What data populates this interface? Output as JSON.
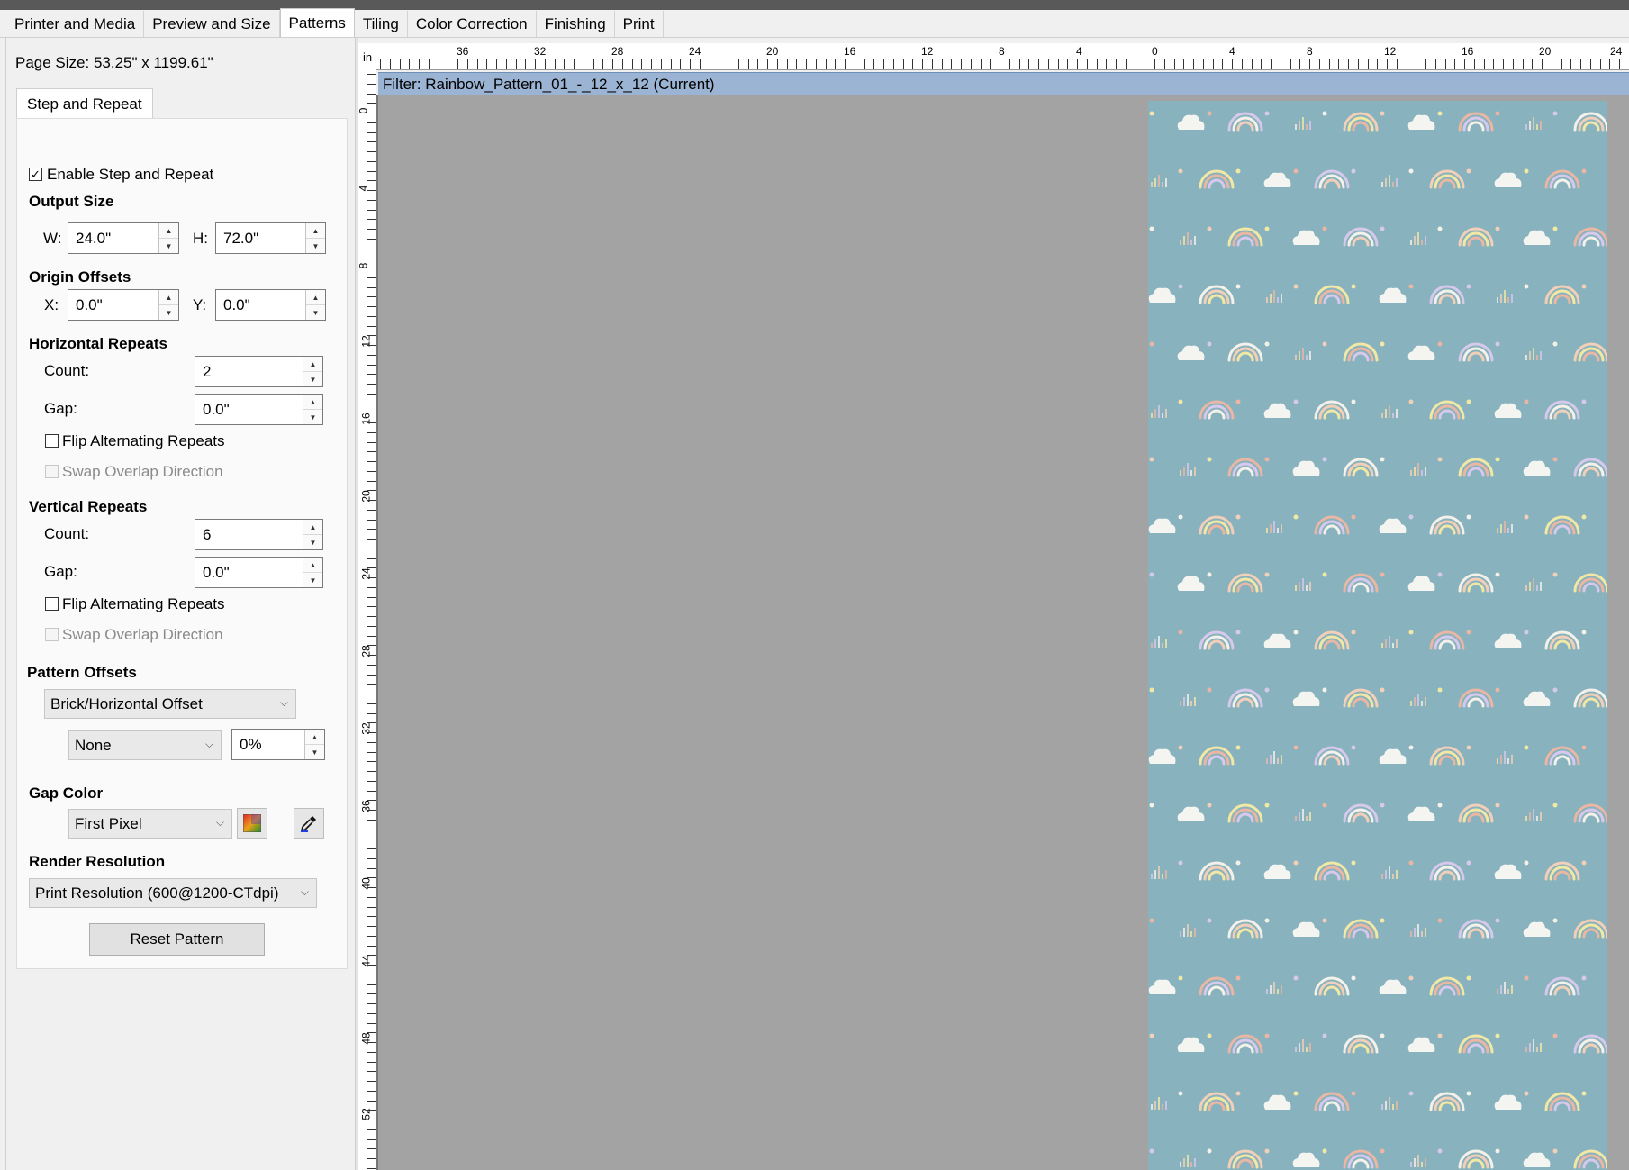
{
  "tabs": [
    {
      "label": "Printer and Media",
      "active": false
    },
    {
      "label": "Preview and Size",
      "active": false
    },
    {
      "label": "Patterns",
      "active": true
    },
    {
      "label": "Tiling",
      "active": false
    },
    {
      "label": "Color Correction",
      "active": false
    },
    {
      "label": "Finishing",
      "active": false
    },
    {
      "label": "Print",
      "active": false
    }
  ],
  "page_size": "Page Size: 53.25\" x 1199.61\"",
  "subtab": "Step and Repeat",
  "enable_step_repeat": {
    "label": "Enable Step and Repeat",
    "checked": true
  },
  "output_size": {
    "title": "Output Size",
    "w_label": "W:",
    "w_value": "24.0\"",
    "h_label": "H:",
    "h_value": "72.0\""
  },
  "origin_offsets": {
    "title": "Origin Offsets",
    "x_label": "X:",
    "x_value": "0.0\"",
    "y_label": "Y:",
    "y_value": "0.0\""
  },
  "horizontal_repeats": {
    "title": "Horizontal Repeats",
    "count_label": "Count:",
    "count_value": "2",
    "gap_label": "Gap:",
    "gap_value": "0.0\"",
    "flip_label": "Flip Alternating Repeats",
    "swap_label": "Swap Overlap Direction"
  },
  "vertical_repeats": {
    "title": "Vertical Repeats",
    "count_label": "Count:",
    "count_value": "6",
    "gap_label": "Gap:",
    "gap_value": "0.0\"",
    "flip_label": "Flip Alternating Repeats",
    "swap_label": "Swap Overlap Direction"
  },
  "pattern_offsets": {
    "title": "Pattern Offsets",
    "mode": "Brick/Horizontal Offset",
    "sub_mode": "None",
    "percent": "0%"
  },
  "gap_color": {
    "title": "Gap Color",
    "mode": "First Pixel",
    "picker_icon": "color-gradient-icon",
    "eyedropper_icon": "eyedropper-icon"
  },
  "render_resolution": {
    "title": "Render Resolution",
    "value": "Print Resolution (600@1200-CTdpi)"
  },
  "reset_button": "Reset Pattern",
  "ruler": {
    "unit": "in",
    "h_labels": [
      "36",
      "32",
      "28",
      "24",
      "20",
      "16",
      "12",
      "8",
      "4",
      "0",
      "4",
      "8",
      "12",
      "16",
      "20",
      "24"
    ],
    "v_labels": [
      "0",
      "4",
      "8",
      "12",
      "16",
      "20",
      "24",
      "28",
      "32",
      "36",
      "40",
      "44",
      "48",
      "52"
    ]
  },
  "filter_label": "Filter: Rainbow_Pattern_01_-_12_x_12 (Current)",
  "colors": {
    "pattern_bg": "#88b2bd",
    "filter_bar": "#9cb4d3",
    "canvas_bg": "#a3a3a3",
    "rainbow_colors": [
      "#f2e8a6",
      "#e9b7a3",
      "#d6c9ec",
      "#f3f1ea",
      "#f2cfb8"
    ]
  }
}
